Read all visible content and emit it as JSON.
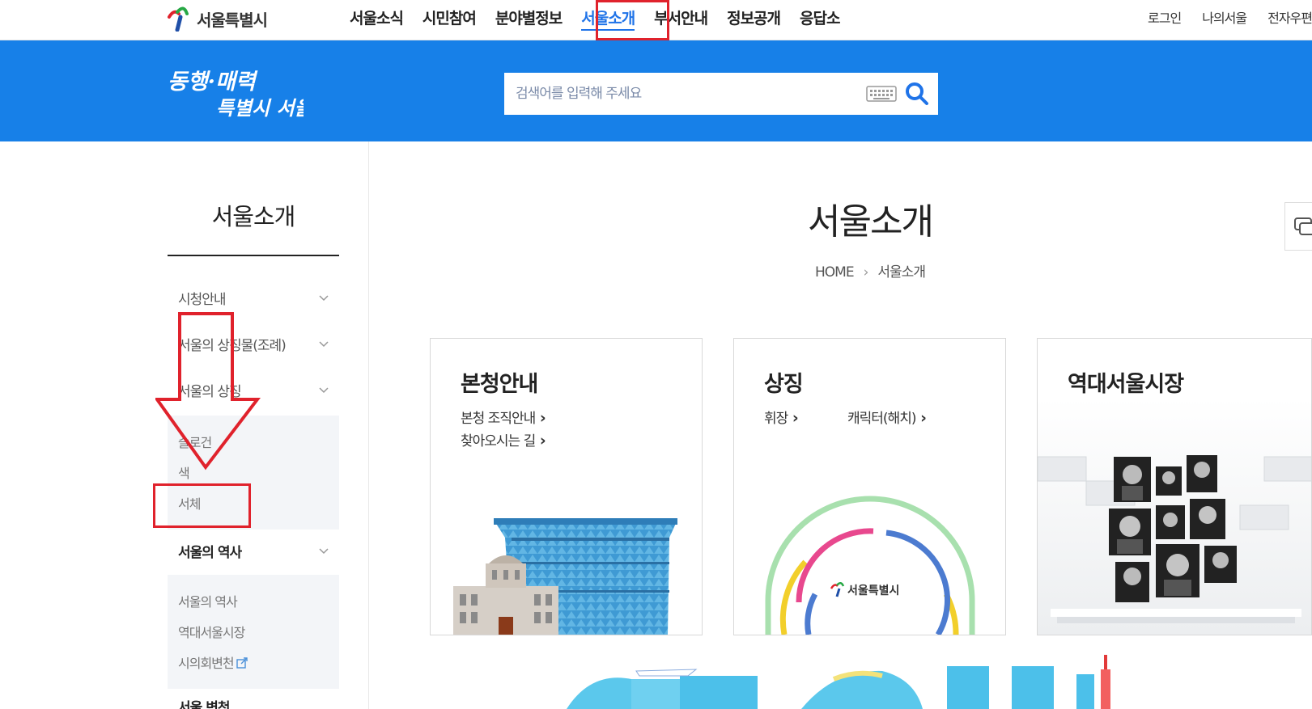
{
  "header": {
    "logo_text": "서울특별시",
    "gnb": [
      "서울소식",
      "시민참여",
      "분야별정보",
      "서울소개",
      "부서안내",
      "정보공개",
      "응답소"
    ],
    "active_index": 3,
    "util": [
      "로그인",
      "나의서울",
      "전자우편"
    ]
  },
  "banner": {
    "slogan_line1": "동행·매력",
    "slogan_line2": "특별시 서울",
    "search_placeholder": "검색어를 입력해 주세요"
  },
  "sidebar": {
    "title": "서울소개",
    "items": [
      "시청안내",
      "서울의 상징물(조례)",
      "서울의 상징",
      "서울의 역사",
      "서울 변천"
    ],
    "symbol_subitems": [
      "슬로건",
      "색",
      "서체"
    ],
    "history_subitems": [
      "서울의 역사",
      "역대서울시장",
      "시의회변천"
    ]
  },
  "main": {
    "title": "서울소개",
    "breadcrumb": [
      "HOME",
      "서울소개"
    ],
    "cards": [
      {
        "title": "본청안내",
        "links": [
          "본청 조직안내",
          "찾아오시는 길"
        ]
      },
      {
        "title": "상징",
        "links": [
          "휘장",
          "캐릭터(해치)"
        ],
        "emblem_text": "서울특별시"
      },
      {
        "title": "역대서울시장",
        "links": []
      }
    ]
  },
  "colors": {
    "brand_blue": "#1780e8",
    "highlight_red": "#e0222c"
  }
}
